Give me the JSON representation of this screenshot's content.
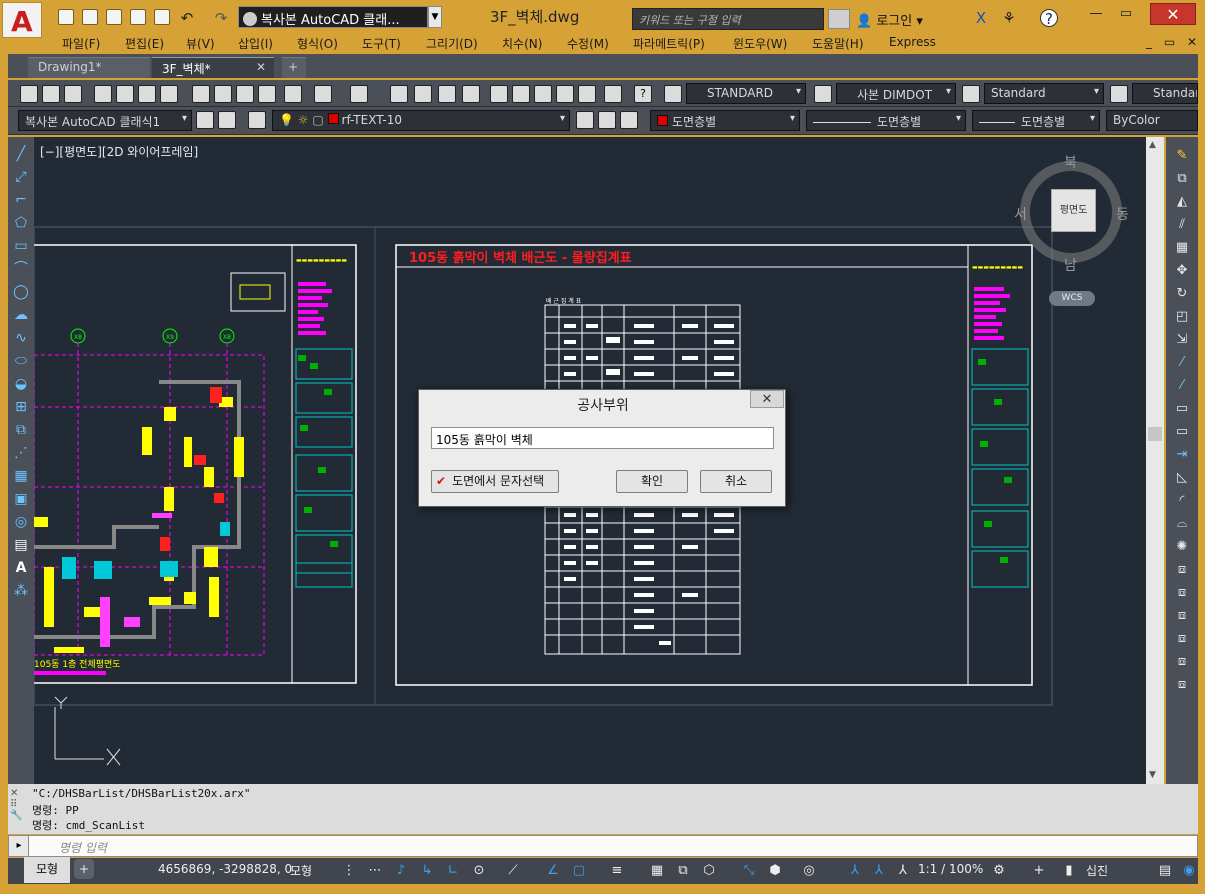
{
  "window": {
    "title": "3F_벽체.dwg",
    "workspace": "복사본 AutoCAD 클래...",
    "search_placeholder": "키워드 또는 구절 입력",
    "login": "로그인"
  },
  "menu": [
    "파일(F)",
    "편집(E)",
    "뷰(V)",
    "삽입(I)",
    "형식(O)",
    "도구(T)",
    "그리기(D)",
    "치수(N)",
    "수정(M)",
    "파라메트릭(P)",
    "윈도우(W)",
    "도움말(H)",
    "Express"
  ],
  "tabs": [
    {
      "label": "Drawing1*"
    },
    {
      "label": "3F_벽체*"
    }
  ],
  "toolbar1": {
    "text_style": "STANDARD",
    "dim_style": "사본 DIMDOT",
    "table_style": "Standard",
    "mleader_style": "Standard"
  },
  "toolbar2": {
    "workspace": "복사본 AutoCAD 클래식1",
    "layer": "rf-TEXT-10",
    "color": "도면층별",
    "linetype": "도면층별",
    "lineweight": "도면층별",
    "plotstyle": "ByColor"
  },
  "viewport_label": "[−][평면도][2D 와이어프레임]",
  "viewcube": {
    "face": "평면도",
    "north": "북",
    "south": "남",
    "east": "동",
    "west": "서",
    "wcs": "WCS"
  },
  "drawing": {
    "sheet_title": "105동 흙막이 벽체 배근도 - 물량집계표",
    "plan_caption": "105동 1층 전체평면도",
    "table_header": "배 근 집 계 표",
    "grid_labels": [
      "X8",
      "X9",
      "X8"
    ],
    "colors": {
      "frame": "#ffffff",
      "magenta": "#ff00ff",
      "yellow": "#ffff00",
      "red": "#ff2020",
      "cyan": "#00c8d8",
      "green": "#00c000"
    }
  },
  "command": {
    "lines": [
      "\"C:/DHSBarList/DHSBarList20x.arx\"",
      "명령: PP",
      "명령: cmd_ScanList"
    ],
    "input_placeholder": "명령 입력"
  },
  "status": {
    "layout_tab": "모형",
    "coords": "4656869, -3298828, 0",
    "model": "모형",
    "scale": "1:1 / 100%",
    "decimal": "십진"
  },
  "dialog": {
    "title": "공사부위",
    "input_value": "105동 흙막이 벽체",
    "select_button": "도면에서 문자선택",
    "ok": "확인",
    "cancel": "취소"
  }
}
